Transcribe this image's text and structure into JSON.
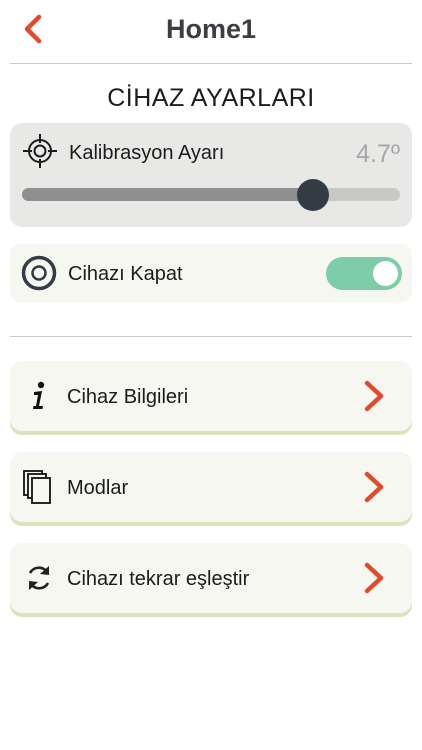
{
  "header": {
    "title": "Home1",
    "back_icon": "chevron-left-icon"
  },
  "colors": {
    "accent": "#e24a2a",
    "title": "#3b3f44",
    "toggle_on": "#7fcca8",
    "slider_thumb": "#333c45",
    "row_shadow": "#d9e4be"
  },
  "section": {
    "title": "CİHAZ AYARLARI"
  },
  "calibration": {
    "icon": "crosshair-icon",
    "label": "Kalibrasyon Ayarı",
    "value_text": "4.7º",
    "slider_fraction": 0.77
  },
  "power": {
    "icon": "power-ring-icon",
    "label": "Cihazı Kapat",
    "enabled": true
  },
  "menu": {
    "items": [
      {
        "icon": "info-icon",
        "label": "Cihaz Bilgileri"
      },
      {
        "icon": "documents-icon",
        "label": "Modlar"
      },
      {
        "icon": "sync-icon",
        "label": "Cihazı tekrar eşleştir"
      }
    ]
  }
}
